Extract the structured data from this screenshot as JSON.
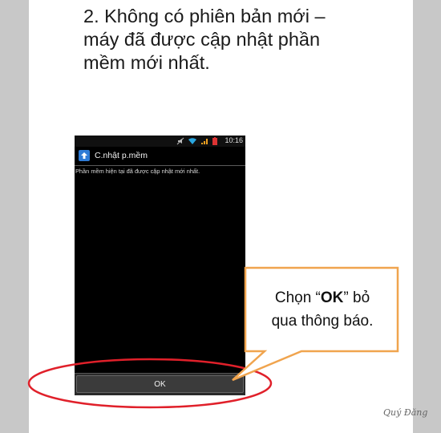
{
  "slide": {
    "heading": "2. Không có phiên bản mới –\nmáy đã được cập nhật phần\nmềm mới nhất."
  },
  "phone": {
    "status_time": "10:16",
    "status_icons": [
      "no-sound-icon",
      "wifi-icon",
      "signal-icon",
      "battery-icon"
    ],
    "app_title": "C.nhật p.mềm",
    "message": "Phần mềm hiện tại đã được cập nhật mới nhất.",
    "ok_label": "OK"
  },
  "callout": {
    "line1_before": "Chọn “",
    "line1_bold": "OK",
    "line1_after": "” bỏ",
    "line2": "qua thông báo."
  },
  "watermark": "Quý Đăng",
  "colors": {
    "callout_border": "#f0a44e",
    "highlight_ellipse": "#e0202a",
    "app_icon": "#2e7bd6"
  }
}
